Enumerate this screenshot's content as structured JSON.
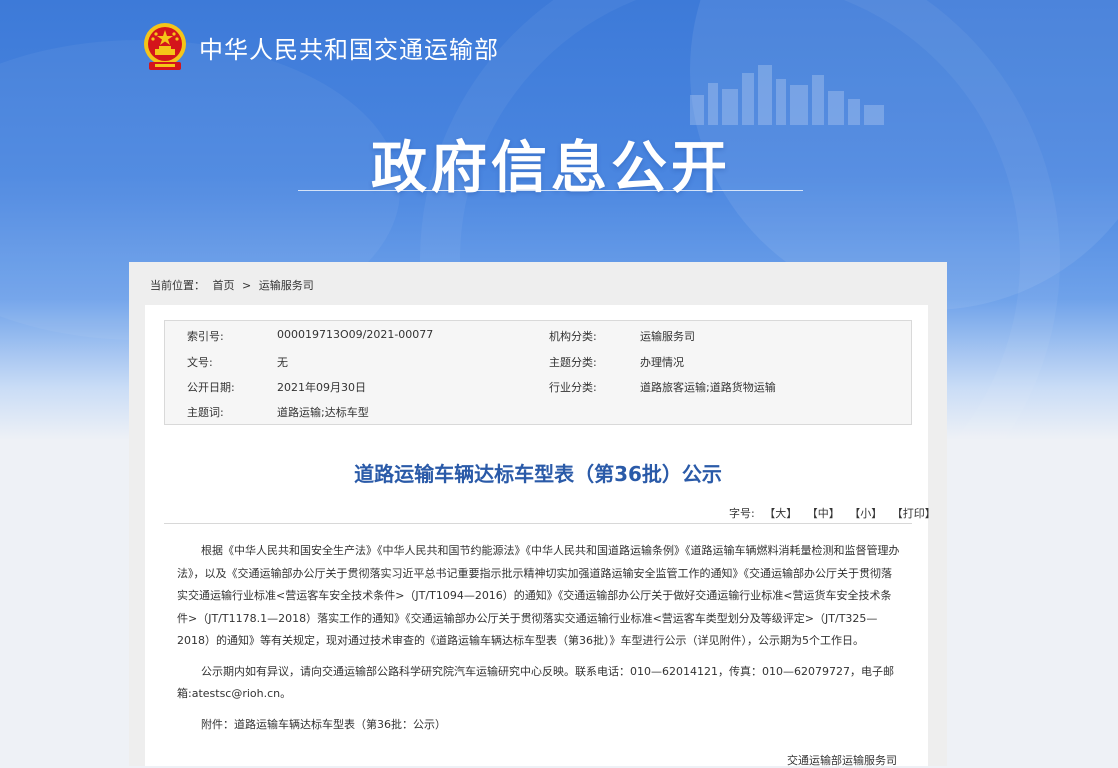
{
  "header": {
    "ministry_name": "中华人民共和国交通运输部",
    "banner_title": "政府信息公开"
  },
  "breadcrumb": {
    "label": "当前位置：",
    "items": [
      "首页",
      ">",
      "运输服务司"
    ]
  },
  "meta": {
    "index_no_label": "索引号:",
    "index_no_value": "000019713O09/2021-00077",
    "org_label": "机构分类:",
    "org_value": "运输服务司",
    "doc_no_label": "文号:",
    "doc_no_value": "无",
    "topic_label": "主题分类:",
    "topic_value": "办理情况",
    "date_label": "公开日期:",
    "date_value": "2021年09月30日",
    "industry_label": "行业分类:",
    "industry_value": "道路旅客运输;道路货物运输",
    "keywords_label": "主题词:",
    "keywords_value": "道路运输;达标车型"
  },
  "article": {
    "title": "道路运输车辆达标车型表（第36批）公示",
    "fontsize_label": "字号:",
    "fontsize_options": [
      "【大】",
      "【中】",
      "【小】",
      "【打印】"
    ],
    "paragraphs": [
      "根据《中华人民共和国安全生产法》《中华人民共和国节约能源法》《中华人民共和国道路运输条例》《道路运输车辆燃料消耗量检测和监督管理办法》，以及《交通运输部办公厅关于贯彻落实习近平总书记重要指示批示精神切实加强道路运输安全监管工作的通知》《交通运输部办公厅关于贯彻落实交通运输行业标准<营运客车安全技术条件>（JT/T1094—2016）的通知》《交通运输部办公厅关于做好交通运输行业标准<营运货车安全技术条件>（JT/T1178.1—2018）落实工作的通知》《交通运输部办公厅关于贯彻落实交通运输行业标准<营运客车类型划分及等级评定>（JT/T325—2018）的通知》等有关规定，现对通过技术审查的《道路运输车辆达标车型表（第36批）》车型进行公示（详见附件），公示期为5个工作日。",
      "公示期内如有异议，请向交通运输部公路科学研究院汽车运输研究中心反映。联系电话：010—62014121，传真：010—62079727，电子邮箱:atestsc@rioh.cn。"
    ],
    "attachment": "附件：道路运输车辆达标车型表（第36批：公示）",
    "signer": "交通运输部运输服务司"
  },
  "colors": {
    "banner_blue": "#4a86e0",
    "title_blue": "#2a5aa8",
    "emblem_red": "#d4151b",
    "emblem_gold": "#f5c518"
  }
}
